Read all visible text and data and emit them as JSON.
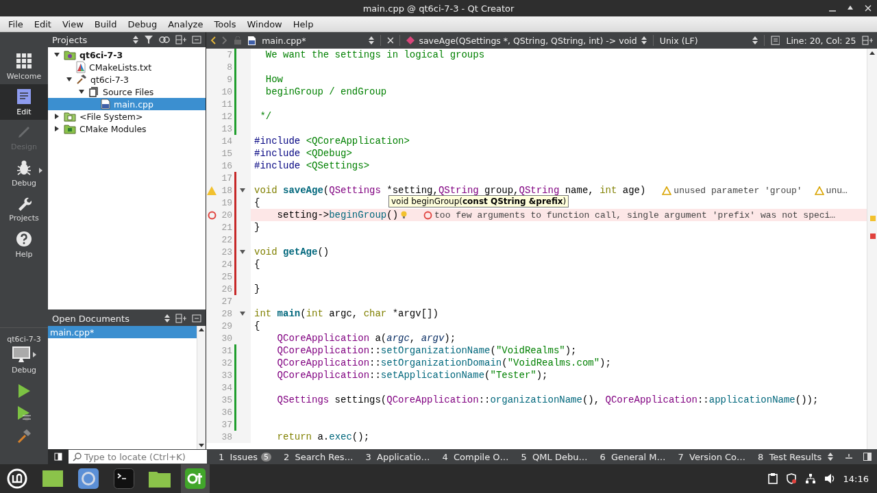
{
  "window": {
    "title": "main.cpp @ qt6ci-7-3 - Qt Creator"
  },
  "menu": [
    "File",
    "Edit",
    "View",
    "Build",
    "Debug",
    "Analyze",
    "Tools",
    "Window",
    "Help"
  ],
  "modes": [
    {
      "label": "Welcome",
      "kind": "grid",
      "selected": false,
      "disabled": false
    },
    {
      "label": "Edit",
      "kind": "document",
      "selected": true,
      "disabled": false
    },
    {
      "label": "Design",
      "kind": "pencil",
      "selected": false,
      "disabled": true
    },
    {
      "label": "Debug",
      "kind": "bug",
      "selected": false,
      "disabled": false
    },
    {
      "label": "Projects",
      "kind": "wrench",
      "selected": false,
      "disabled": false
    },
    {
      "label": "Help",
      "kind": "help",
      "selected": false,
      "disabled": false
    }
  ],
  "target": {
    "project": "qt6ci-7-3",
    "config": "Debug"
  },
  "projects_pane": {
    "title": "Projects",
    "tree": [
      {
        "label": "qt6ci-7-3",
        "kind": "project",
        "expanded": true,
        "selected": false,
        "children": [
          {
            "label": "CMakeLists.txt",
            "kind": "cmake",
            "selected": false
          },
          {
            "label": "qt6ci-7-3",
            "kind": "target",
            "expanded": true,
            "selected": false,
            "children": [
              {
                "label": "Source Files",
                "kind": "group",
                "expanded": true,
                "selected": false,
                "children": [
                  {
                    "label": "main.cpp",
                    "kind": "source",
                    "selected": true
                  }
                ]
              }
            ]
          }
        ]
      },
      {
        "label": "<File System>",
        "kind": "filesystem",
        "expanded": false,
        "selected": false
      },
      {
        "label": "CMake Modules",
        "kind": "modules",
        "expanded": false,
        "selected": false
      }
    ]
  },
  "open_documents": {
    "title": "Open Documents",
    "items": [
      {
        "label": "main.cpp*",
        "selected": true
      }
    ]
  },
  "editor": {
    "file": "main.cpp*",
    "symbol": "saveAge(QSettings *, QString, QString, int) -> void",
    "line_ending": "Unix (LF)",
    "position": "Line: 20, Col: 25",
    "tooltip": "void beginGroup(**const QString &prefix**)",
    "lines": [
      {
        "number": "7",
        "added": true,
        "modified": false,
        "warning": false,
        "error": false,
        "foldable": false,
        "tokens": [
          {
            "kind": "comment",
            "text": "  We want the settings in logical groups"
          }
        ]
      },
      {
        "number": "8",
        "added": true,
        "modified": false,
        "warning": false,
        "error": false,
        "foldable": false
      },
      {
        "number": "9",
        "added": true,
        "modified": false,
        "warning": false,
        "error": false,
        "foldable": false,
        "tokens": [
          {
            "kind": "comment",
            "text": "  How"
          }
        ]
      },
      {
        "number": "10",
        "added": true,
        "modified": false,
        "warning": false,
        "error": false,
        "foldable": false,
        "tokens": [
          {
            "kind": "comment",
            "text": "  beginGroup / endGroup"
          }
        ]
      },
      {
        "number": "11",
        "added": true,
        "modified": false,
        "warning": false,
        "error": false,
        "foldable": false
      },
      {
        "number": "12",
        "added": true,
        "modified": false,
        "warning": false,
        "error": false,
        "foldable": false,
        "tokens": [
          {
            "kind": "comment",
            "text": " */"
          }
        ]
      },
      {
        "number": "13",
        "added": true,
        "modified": false,
        "warning": false,
        "error": false,
        "foldable": false
      },
      {
        "number": "14",
        "added": false,
        "modified": false,
        "warning": false,
        "error": false,
        "foldable": false,
        "tokens": [
          {
            "kind": "preproc",
            "text": "#include "
          },
          {
            "kind": "string",
            "text": "<QCoreApplication>"
          }
        ]
      },
      {
        "number": "15",
        "added": false,
        "modified": false,
        "warning": false,
        "error": false,
        "foldable": false,
        "tokens": [
          {
            "kind": "preproc",
            "text": "#include "
          },
          {
            "kind": "string",
            "text": "<QDebug>"
          }
        ]
      },
      {
        "number": "16",
        "added": false,
        "modified": false,
        "warning": false,
        "error": false,
        "foldable": false,
        "tokens": [
          {
            "kind": "preproc",
            "text": "#include "
          },
          {
            "kind": "string",
            "text": "<QSettings>"
          }
        ]
      },
      {
        "number": "17",
        "added": false,
        "modified": true,
        "warning": false,
        "error": false,
        "foldable": false
      },
      {
        "number": "18",
        "added": false,
        "modified": true,
        "warning": true,
        "error": false,
        "foldable": true,
        "tokens": [
          {
            "kind": "keyword",
            "text": "void "
          },
          {
            "kind": "declaration",
            "text": "saveAge"
          },
          {
            "kind": "plain",
            "text": "("
          },
          {
            "kind": "type",
            "text": "QSettings"
          },
          {
            "kind": "plain",
            "text": " *setting,"
          },
          {
            "kind": "type",
            "text": "QString"
          },
          {
            "kind": "plain",
            "text": " group,"
          },
          {
            "kind": "type",
            "text": "QString"
          },
          {
            "kind": "plain",
            "text": " name, "
          },
          {
            "kind": "keyword",
            "text": "int"
          },
          {
            "kind": "plain",
            "text": " age)"
          }
        ],
        "annotations": [
          {
            "kind": "warning",
            "text": "unused parameter 'group'"
          },
          {
            "kind": "warning",
            "text": "unu…"
          }
        ]
      },
      {
        "number": "19",
        "added": false,
        "modified": true,
        "warning": false,
        "error": false,
        "foldable": false,
        "tokens": [
          {
            "kind": "plain",
            "text": "{"
          }
        ]
      },
      {
        "number": "20",
        "added": false,
        "modified": true,
        "warning": false,
        "error": true,
        "foldable": false,
        "tokens": [
          {
            "kind": "plain",
            "text": "    setting->"
          },
          {
            "kind": "call",
            "text": "beginGroup"
          },
          {
            "kind": "plain",
            "text": "()"
          }
        ],
        "annotations": [
          {
            "kind": "error",
            "text": "too few arguments to function call, single argument 'prefix' was not speci…"
          }
        ]
      },
      {
        "number": "21",
        "added": false,
        "modified": true,
        "warning": false,
        "error": false,
        "foldable": false,
        "tokens": [
          {
            "kind": "plain",
            "text": "}"
          }
        ]
      },
      {
        "number": "22",
        "added": false,
        "modified": true,
        "warning": false,
        "error": false,
        "foldable": false
      },
      {
        "number": "23",
        "added": false,
        "modified": true,
        "warning": false,
        "error": false,
        "foldable": true,
        "tokens": [
          {
            "kind": "keyword",
            "text": "void "
          },
          {
            "kind": "declaration",
            "text": "getAge"
          },
          {
            "kind": "plain",
            "text": "()"
          }
        ]
      },
      {
        "number": "24",
        "added": false,
        "modified": true,
        "warning": false,
        "error": false,
        "foldable": false,
        "tokens": [
          {
            "kind": "plain",
            "text": "{"
          }
        ]
      },
      {
        "number": "25",
        "added": false,
        "modified": true,
        "warning": false,
        "error": false,
        "foldable": false
      },
      {
        "number": "26",
        "added": false,
        "modified": true,
        "warning": false,
        "error": false,
        "foldable": false,
        "tokens": [
          {
            "kind": "plain",
            "text": "}"
          }
        ]
      },
      {
        "number": "27",
        "added": false,
        "modified": false,
        "warning": false,
        "error": false,
        "foldable": false
      },
      {
        "number": "28",
        "added": false,
        "modified": false,
        "warning": false,
        "error": false,
        "foldable": true,
        "tokens": [
          {
            "kind": "keyword",
            "text": "int "
          },
          {
            "kind": "declaration",
            "text": "main"
          },
          {
            "kind": "plain",
            "text": "("
          },
          {
            "kind": "keyword",
            "text": "int"
          },
          {
            "kind": "plain",
            "text": " argc, "
          },
          {
            "kind": "keyword",
            "text": "char"
          },
          {
            "kind": "plain",
            "text": " *argv[])"
          }
        ]
      },
      {
        "number": "29",
        "added": false,
        "modified": false,
        "warning": false,
        "error": false,
        "foldable": false,
        "tokens": [
          {
            "kind": "plain",
            "text": "{"
          }
        ]
      },
      {
        "number": "30",
        "added": false,
        "modified": false,
        "warning": false,
        "error": false,
        "foldable": false,
        "tokens": [
          {
            "kind": "type",
            "text": "    QCoreApplication"
          },
          {
            "kind": "plain",
            "text": " a("
          },
          {
            "kind": "parameter",
            "text": "argc"
          },
          {
            "kind": "plain",
            "text": ", "
          },
          {
            "kind": "parameter",
            "text": "argv"
          },
          {
            "kind": "plain",
            "text": ");"
          }
        ]
      },
      {
        "number": "31",
        "added": true,
        "modified": false,
        "warning": false,
        "error": false,
        "foldable": false,
        "tokens": [
          {
            "kind": "type",
            "text": "    QCoreApplication"
          },
          {
            "kind": "plain",
            "text": "::"
          },
          {
            "kind": "call",
            "text": "setOrganizationName"
          },
          {
            "kind": "plain",
            "text": "("
          },
          {
            "kind": "string",
            "text": "\"VoidRealms\""
          },
          {
            "kind": "plain",
            "text": ");"
          }
        ]
      },
      {
        "number": "32",
        "added": true,
        "modified": false,
        "warning": false,
        "error": false,
        "foldable": false,
        "tokens": [
          {
            "kind": "type",
            "text": "    QCoreApplication"
          },
          {
            "kind": "plain",
            "text": "::"
          },
          {
            "kind": "call",
            "text": "setOrganizationDomain"
          },
          {
            "kind": "plain",
            "text": "("
          },
          {
            "kind": "string",
            "text": "\"VoidRealms.com\""
          },
          {
            "kind": "plain",
            "text": ");"
          }
        ]
      },
      {
        "number": "33",
        "added": true,
        "modified": false,
        "warning": false,
        "error": false,
        "foldable": false,
        "tokens": [
          {
            "kind": "type",
            "text": "    QCoreApplication"
          },
          {
            "kind": "plain",
            "text": "::"
          },
          {
            "kind": "call",
            "text": "setApplicationName"
          },
          {
            "kind": "plain",
            "text": "("
          },
          {
            "kind": "string",
            "text": "\"Tester\""
          },
          {
            "kind": "plain",
            "text": ");"
          }
        ]
      },
      {
        "number": "34",
        "added": true,
        "modified": false,
        "warning": false,
        "error": false,
        "foldable": false
      },
      {
        "number": "35",
        "added": true,
        "modified": false,
        "warning": false,
        "error": false,
        "foldable": false,
        "tokens": [
          {
            "kind": "type",
            "text": "    QSettings"
          },
          {
            "kind": "plain",
            "text": " settings("
          },
          {
            "kind": "type",
            "text": "QCoreApplication"
          },
          {
            "kind": "plain",
            "text": "::"
          },
          {
            "kind": "call",
            "text": "organizationName"
          },
          {
            "kind": "plain",
            "text": "(), "
          },
          {
            "kind": "type",
            "text": "QCoreApplication"
          },
          {
            "kind": "plain",
            "text": "::"
          },
          {
            "kind": "call",
            "text": "applicationName"
          },
          {
            "kind": "plain",
            "text": "());"
          }
        ]
      },
      {
        "number": "36",
        "added": true,
        "modified": false,
        "warning": false,
        "error": false,
        "foldable": false
      },
      {
        "number": "37",
        "added": true,
        "modified": false,
        "warning": false,
        "error": false,
        "foldable": false
      },
      {
        "number": "38",
        "added": false,
        "modified": false,
        "warning": false,
        "error": false,
        "foldable": false,
        "tokens": [
          {
            "kind": "keyword",
            "text": "    return"
          },
          {
            "kind": "plain",
            "text": " a."
          },
          {
            "kind": "call",
            "text": "exec"
          },
          {
            "kind": "plain",
            "text": "();"
          }
        ]
      }
    ]
  },
  "output_bar": {
    "locate_placeholder": "Type to locate (Ctrl+K)",
    "tabs": [
      {
        "number": "1",
        "label": "Issues",
        "badge": "5"
      },
      {
        "number": "2",
        "label": "Search Res…"
      },
      {
        "number": "3",
        "label": "Applicatio…"
      },
      {
        "number": "4",
        "label": "Compile O…"
      },
      {
        "number": "5",
        "label": "QML Debu…"
      },
      {
        "number": "6",
        "label": "General M…"
      },
      {
        "number": "7",
        "label": "Version Co…"
      },
      {
        "number": "8",
        "label": "Test Results"
      }
    ]
  },
  "taskbar": {
    "clock": "14:16"
  }
}
